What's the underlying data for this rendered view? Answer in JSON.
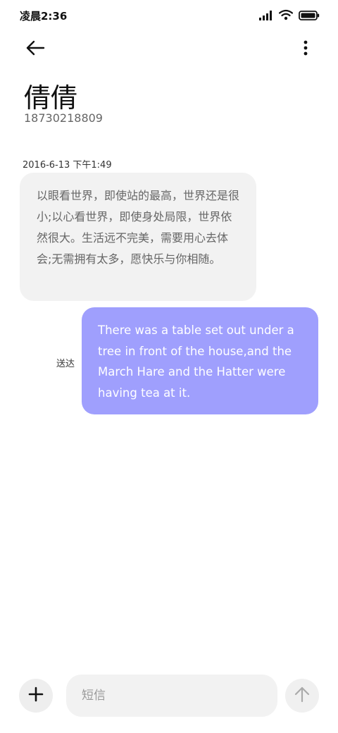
{
  "status_bar": {
    "time": "凌晨2:36",
    "icons": [
      "signal-icon",
      "wifi-icon",
      "battery-icon"
    ]
  },
  "header": {
    "back_icon": "arrow-left-icon",
    "more_icon": "more-vertical-icon"
  },
  "contact": {
    "name": "倩倩",
    "number": "18730218809"
  },
  "messages": [
    {
      "direction": "received",
      "timestamp": "2016-6-13 下午1:49",
      "text": "以眼看世界，即使站的最高，世界还是很小;以心看世界，即使身处局限，世界依然很大。生活远不完美，需要用心去体会;无需拥有太多，愿快乐与你相随。"
    },
    {
      "direction": "sent",
      "status": "送达",
      "text": "There was a table set out under a tree in front of the house,and the March Hare and the Hatter were having tea at it."
    }
  ],
  "composer": {
    "placeholder": "短信",
    "value": "",
    "add_icon": "plus-icon",
    "send_icon": "arrow-up-icon"
  },
  "colors": {
    "sent_bubble": "#9f9ffd",
    "received_bubble": "#f2f2f2",
    "background": "#ffffff"
  }
}
